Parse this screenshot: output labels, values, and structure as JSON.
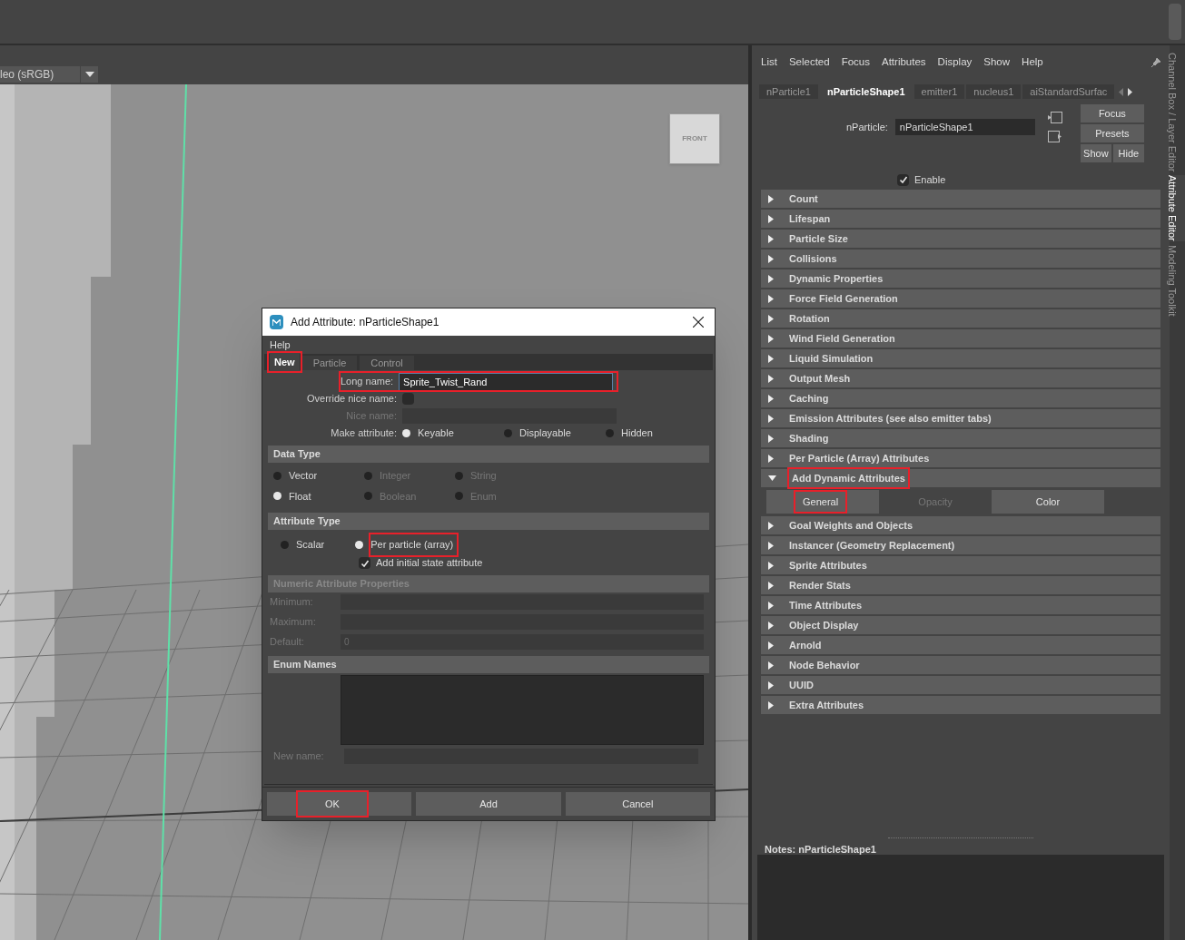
{
  "viewport": {
    "color_space": "leo (sRGB)",
    "view_cube_label": "FRONT"
  },
  "dialog": {
    "title": "Add Attribute: nParticleShape1",
    "menu": [
      "Help"
    ],
    "tabs": [
      {
        "label": "New",
        "selected": true,
        "highlighted": true
      },
      {
        "label": "Particle",
        "selected": false,
        "highlighted": false
      },
      {
        "label": "Control",
        "selected": false,
        "highlighted": false
      }
    ],
    "long_name": {
      "label": "Long name:",
      "value": "Sprite_Twist_Rand",
      "highlighted": true
    },
    "override_nice_name": {
      "label": "Override nice name:",
      "checked": false
    },
    "nice_name": {
      "label": "Nice name:",
      "disabled": true
    },
    "make_attribute": {
      "label": "Make attribute:",
      "options": [
        {
          "label": "Keyable",
          "selected": true
        },
        {
          "label": "Displayable",
          "selected": false
        },
        {
          "label": "Hidden",
          "selected": false
        }
      ]
    },
    "data_type": {
      "title": "Data Type",
      "options": [
        {
          "label": "Vector",
          "selected": false,
          "disabled": false
        },
        {
          "label": "Integer",
          "selected": false,
          "disabled": true
        },
        {
          "label": "String",
          "selected": false,
          "disabled": true
        },
        {
          "label": "Float",
          "selected": true,
          "disabled": false
        },
        {
          "label": "Boolean",
          "selected": false,
          "disabled": true
        },
        {
          "label": "Enum",
          "selected": false,
          "disabled": true
        }
      ]
    },
    "attribute_type": {
      "title": "Attribute Type",
      "options": [
        {
          "label": "Scalar",
          "selected": false,
          "highlighted": false
        },
        {
          "label": "Per particle (array)",
          "selected": true,
          "highlighted": true
        }
      ],
      "initial_state": {
        "label": "Add initial state attribute",
        "checked": true
      }
    },
    "numeric": {
      "title": "Numeric Attribute Properties",
      "disabled": true,
      "fields": [
        {
          "label": "Minimum:"
        },
        {
          "label": "Maximum:"
        },
        {
          "label": "Default:",
          "value": "0"
        }
      ]
    },
    "enum_names": {
      "title": "Enum Names",
      "new_name_label": "New name:"
    },
    "buttons": [
      {
        "label": "OK",
        "highlighted": true
      },
      {
        "label": "Add",
        "highlighted": false
      },
      {
        "label": "Cancel",
        "highlighted": false
      }
    ]
  },
  "attribute_editor": {
    "menu": [
      "List",
      "Selected",
      "Focus",
      "Attributes",
      "Display",
      "Show",
      "Help"
    ],
    "tabs": [
      {
        "label": "nParticle1",
        "selected": false
      },
      {
        "label": "nParticleShape1",
        "selected": true
      },
      {
        "label": "emitter1",
        "selected": false
      },
      {
        "label": "nucleus1",
        "selected": false
      },
      {
        "label": "aiStandardSurfac",
        "selected": false
      }
    ],
    "node_label": "nParticle:",
    "node_value": "nParticleShape1",
    "buttons": [
      "Focus",
      "Presets",
      "Show",
      "Hide"
    ],
    "enable": {
      "label": "Enable",
      "checked": true
    },
    "sections": [
      {
        "label": "Count",
        "expanded": false,
        "highlighted": false
      },
      {
        "label": "Lifespan",
        "expanded": false,
        "highlighted": false
      },
      {
        "label": "Particle Size",
        "expanded": false,
        "highlighted": false
      },
      {
        "label": "Collisions",
        "expanded": false,
        "highlighted": false
      },
      {
        "label": "Dynamic Properties",
        "expanded": false,
        "highlighted": false
      },
      {
        "label": "Force Field Generation",
        "expanded": false,
        "highlighted": false
      },
      {
        "label": "Rotation",
        "expanded": false,
        "highlighted": false
      },
      {
        "label": "Wind Field Generation",
        "expanded": false,
        "highlighted": false
      },
      {
        "label": "Liquid Simulation",
        "expanded": false,
        "highlighted": false
      },
      {
        "label": "Output Mesh",
        "expanded": false,
        "highlighted": false
      },
      {
        "label": "Caching",
        "expanded": false,
        "highlighted": false
      },
      {
        "label": "Emission Attributes (see also emitter tabs)",
        "expanded": false,
        "highlighted": false
      },
      {
        "label": "Shading",
        "expanded": false,
        "highlighted": false
      },
      {
        "label": "Per Particle (Array) Attributes",
        "expanded": false,
        "highlighted": false
      },
      {
        "label": "Add Dynamic Attributes",
        "expanded": true,
        "highlighted": true,
        "buttons": [
          {
            "label": "General",
            "disabled": false,
            "highlighted": true
          },
          {
            "label": "Opacity",
            "disabled": true,
            "highlighted": false
          },
          {
            "label": "Color",
            "disabled": false,
            "highlighted": false
          }
        ]
      },
      {
        "label": "Goal Weights and Objects",
        "expanded": false,
        "highlighted": false
      },
      {
        "label": "Instancer (Geometry Replacement)",
        "expanded": false,
        "highlighted": false
      },
      {
        "label": "Sprite Attributes",
        "expanded": false,
        "highlighted": false
      },
      {
        "label": "Render Stats",
        "expanded": false,
        "highlighted": false
      },
      {
        "label": "Time Attributes",
        "expanded": false,
        "highlighted": false
      },
      {
        "label": "Object Display",
        "expanded": false,
        "highlighted": false
      },
      {
        "label": "Arnold",
        "expanded": false,
        "highlighted": false
      },
      {
        "label": "Node Behavior",
        "expanded": false,
        "highlighted": false
      },
      {
        "label": "UUID",
        "expanded": false,
        "highlighted": false
      },
      {
        "label": "Extra Attributes",
        "expanded": false,
        "highlighted": false
      }
    ],
    "notes_label": "Notes:  nParticleShape1"
  },
  "side_tabs": [
    {
      "label": "Channel Box / Layer Editor",
      "selected": false
    },
    {
      "label": "Attribute Editor",
      "selected": true
    },
    {
      "label": "Modeling Toolkit",
      "selected": false
    }
  ]
}
